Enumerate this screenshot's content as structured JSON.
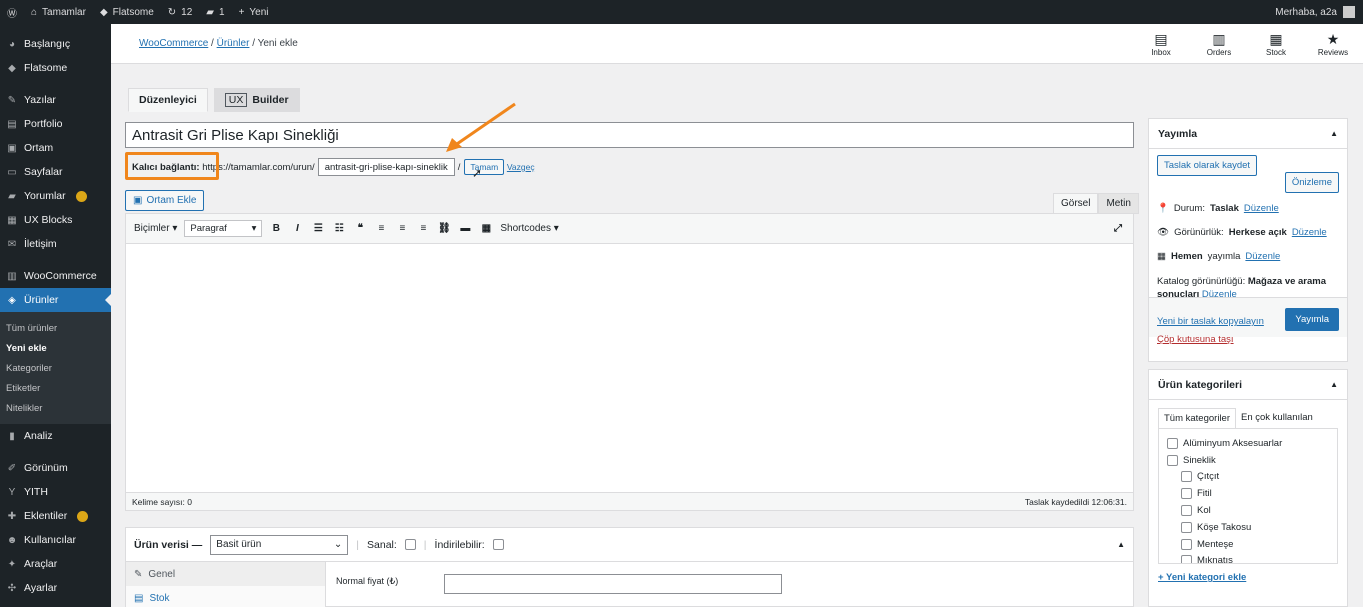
{
  "adminbar": {
    "site": "Tamamlar",
    "theme": "Flatsome",
    "updates": "12",
    "comments": "1",
    "new": "Yeni",
    "greeting": "Merhaba, a2a"
  },
  "sidebar": {
    "items": [
      {
        "label": "Başlangıç",
        "icon": "◕"
      },
      {
        "label": "Flatsome",
        "icon": "◆"
      },
      {
        "label": "Yazılar",
        "icon": "✎"
      },
      {
        "label": "Portfolio",
        "icon": "▤"
      },
      {
        "label": "Ortam",
        "icon": "▣"
      },
      {
        "label": "Sayfalar",
        "icon": "▭"
      },
      {
        "label": "Yorumlar",
        "icon": "▰"
      },
      {
        "label": "UX Blocks",
        "icon": "▦"
      },
      {
        "label": "İletişim",
        "icon": "✉"
      },
      {
        "label": "WooCommerce",
        "icon": "▥"
      },
      {
        "label": "Ürünler",
        "icon": "◈"
      }
    ],
    "submenu": [
      "Tüm ürünler",
      "Yeni ekle",
      "Kategoriler",
      "Etiketler",
      "Nitelikler"
    ],
    "items2": [
      {
        "label": "Analiz",
        "icon": "▮"
      },
      {
        "label": "Görünüm",
        "icon": "✐"
      },
      {
        "label": "YITH",
        "icon": "Y"
      },
      {
        "label": "Eklentiler",
        "icon": "✚"
      },
      {
        "label": "Kullanıcılar",
        "icon": "☻"
      },
      {
        "label": "Araçlar",
        "icon": "✦"
      },
      {
        "label": "Ayarlar",
        "icon": "✣"
      }
    ]
  },
  "breadcrumb": {
    "woo": "WooCommerce",
    "products": "Ürünler",
    "current": "Yeni ekle"
  },
  "toolbar_icons": [
    {
      "label": "Inbox"
    },
    {
      "label": "Orders"
    },
    {
      "label": "Stock"
    },
    {
      "label": "Reviews"
    }
  ],
  "editor_tabs": {
    "duzenleyici": "Düzenleyici",
    "ux": "UX",
    "builder": "Builder"
  },
  "title": "Antrasit Gri Plise Kapı Sinekliği",
  "permalink": {
    "label": "Kalıcı bağlantı:",
    "base": "https://tamamlar.com/urun/",
    "slug": "antrasit-gri-plise-kapı-sineklik",
    "sep": "/",
    "ok": "Tamam",
    "cancel": "Vazgeç"
  },
  "media_button": "Ortam Ekle",
  "view_tabs": {
    "visual": "Görsel",
    "text": "Metin"
  },
  "format_toolbar": {
    "bicimler": "Biçimler",
    "paragraf": "Paragraf",
    "shortcodes": "Shortcodes"
  },
  "status": {
    "words": "Kelime sayısı: 0",
    "saved": "Taslak kaydedildi 12:06:31."
  },
  "product_data": {
    "label": "Ürün verisi —",
    "type": "Basit ürün",
    "virtual": "Sanal:",
    "downloadable": "İndirilebilir:",
    "tabs": [
      "Genel",
      "Stok"
    ],
    "price_label": "Normal fiyat (₺)"
  },
  "publish": {
    "title": "Yayımla",
    "save_draft": "Taslak olarak kaydet",
    "preview": "Önizleme",
    "status_label": "Durum:",
    "status_value": "Taslak",
    "edit": "Düzenle",
    "visibility_label": "Görünürlük:",
    "visibility_value": "Herkese açık",
    "publish_label": "Hemen",
    "publish_tail": "yayımla",
    "catalog_label": "Katalog görünürlüğü:",
    "catalog_value": "Mağaza ve arama",
    "catalog_value2": "sonuçları",
    "copy": "Yeni bir taslak kopyalayın",
    "trash": "Çöp kutusuna taşı",
    "publish_btn": "Yayımla"
  },
  "categories": {
    "title": "Ürün kategorileri",
    "tab_all": "Tüm kategoriler",
    "tab_popular": "En çok kullanılan",
    "items": [
      {
        "label": "Alüminyum Aksesuarlar",
        "child": false
      },
      {
        "label": "Sineklik",
        "child": false
      },
      {
        "label": "Çıtçıt",
        "child": true
      },
      {
        "label": "Fitil",
        "child": true
      },
      {
        "label": "Kol",
        "child": true
      },
      {
        "label": "Köşe Takosu",
        "child": true
      },
      {
        "label": "Menteşe",
        "child": true
      },
      {
        "label": "Mıknatıs",
        "child": true
      }
    ],
    "add": "+ Yeni kategori ekle"
  }
}
